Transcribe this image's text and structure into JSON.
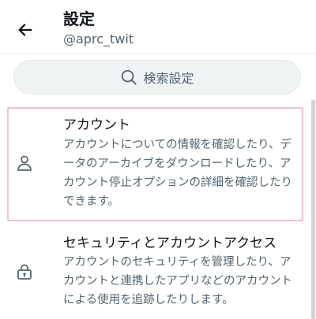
{
  "header": {
    "title": "設定",
    "handle": "@aprc_twit",
    "back_icon": "arrow-left-icon"
  },
  "search": {
    "label": "検索設定",
    "icon": "search-icon"
  },
  "items": [
    {
      "title": "アカウント",
      "description": "アカウントについての情報を確認したり、データのアーカイブをダウンロードしたり、アカウント停止オプションの詳細を確認したりできます。",
      "icon": "person-icon"
    },
    {
      "title": "セキュリティとアカウントアクセス",
      "description": "アカウントのセキュリティを管理したり、アカウントと連携したアプリなどのアカウントによる使用を追跡したりします。",
      "icon": "lock-icon"
    }
  ],
  "colors": {
    "text_primary": "#0f1419",
    "text_secondary": "#536471",
    "search_bg": "#eff3f4",
    "highlight_border": "#f4bfd3"
  }
}
